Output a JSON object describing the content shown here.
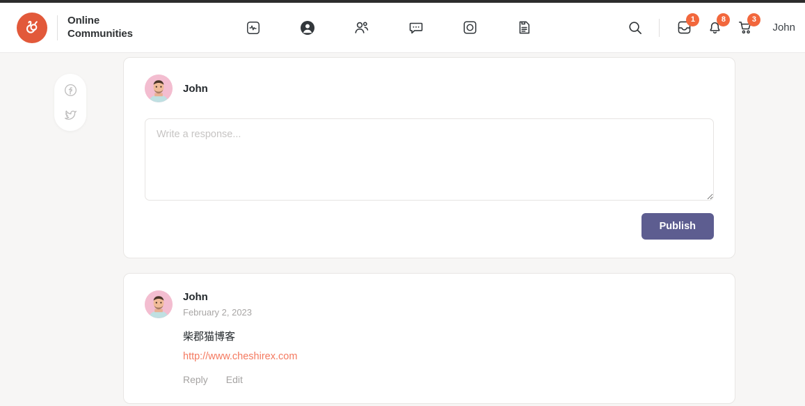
{
  "brand": {
    "logo_icon": "online-communities-logo-icon",
    "line1": "Online",
    "line2": "Communities"
  },
  "nav": {
    "items": [
      {
        "icon": "activity-pulse-icon",
        "name": "nav-item-activity"
      },
      {
        "icon": "user-circle-icon",
        "name": "nav-item-profile"
      },
      {
        "icon": "group-people-icon",
        "name": "nav-item-members"
      },
      {
        "icon": "chat-bubble-icon",
        "name": "nav-item-messages"
      },
      {
        "icon": "media-circle-icon",
        "name": "nav-item-media"
      },
      {
        "icon": "document-note-icon",
        "name": "nav-item-documents"
      }
    ]
  },
  "actions": {
    "search_icon": "search-icon",
    "inbox": {
      "icon": "inbox-icon",
      "badge": "1"
    },
    "notifications": {
      "icon": "bell-icon",
      "badge": "8"
    },
    "cart": {
      "icon": "shopping-cart-icon",
      "badge": "3"
    },
    "user_name": "John"
  },
  "social_rail": {
    "items": [
      {
        "icon": "facebook-icon",
        "name": "social-facebook"
      },
      {
        "icon": "twitter-icon",
        "name": "social-twitter"
      }
    ]
  },
  "composer": {
    "author": "John",
    "avatar_icon": "user-avatar-photo",
    "placeholder": "Write a response...",
    "value": "",
    "publish_label": "Publish"
  },
  "comment": {
    "author": "John",
    "avatar_icon": "user-avatar-photo",
    "date": "February 2, 2023",
    "title": "柴郡猫博客",
    "link": "http://www.cheshirex.com",
    "reply_label": "Reply",
    "edit_label": "Edit"
  },
  "colors": {
    "brand_orange": "#e2593a",
    "badge_orange": "#f2673c",
    "link_orange": "#f4795f",
    "publish_purple": "#5d5d90",
    "page_bg": "#f7f6f5",
    "card_bg": "#ffffff",
    "top_strip": "#2c2c2c"
  }
}
